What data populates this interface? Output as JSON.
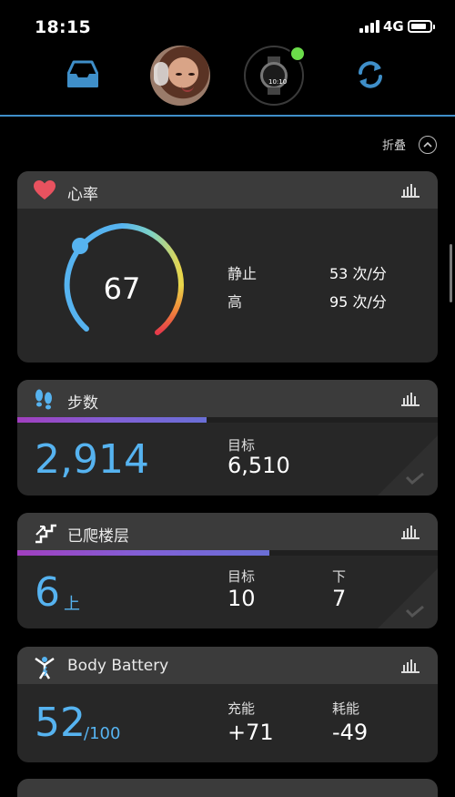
{
  "status_bar": {
    "time": "18:15",
    "network": "4G"
  },
  "header": {
    "collapse_label": "折叠"
  },
  "heart_rate": {
    "title": "心率",
    "current": "67",
    "resting_label": "静止",
    "resting_value": "53 次/分",
    "high_label": "高",
    "high_value": "95 次/分"
  },
  "steps": {
    "title": "步数",
    "value": "2,914",
    "goal_label": "目标",
    "goal_value": "6,510",
    "progress": 0.45
  },
  "floors": {
    "title": "已爬楼层",
    "value": "6",
    "unit": "上",
    "goal_label": "目标",
    "goal_value": "10",
    "down_label": "下",
    "down_value": "7",
    "progress": 0.6
  },
  "body_battery": {
    "title": "Body Battery",
    "value": "52",
    "max": "/100",
    "charged_label": "充能",
    "charged_value": "+71",
    "drained_label": "耗能",
    "drained_value": "-49"
  },
  "colors": {
    "accent_blue": "#56b3f0",
    "nav_blue": "#3f8fc9",
    "heart_red": "#e8525f",
    "connected_green": "#6bdc4a"
  },
  "icons": {
    "inbox": "inbox-tray-icon",
    "sync": "sync-arrows-icon",
    "heart": "heart-icon",
    "steps": "footprints-icon",
    "floors": "stairs-icon",
    "body_battery": "body-battery-figure-icon",
    "chart": "bar-chart-icon",
    "collapse": "chevron-up-icon"
  }
}
